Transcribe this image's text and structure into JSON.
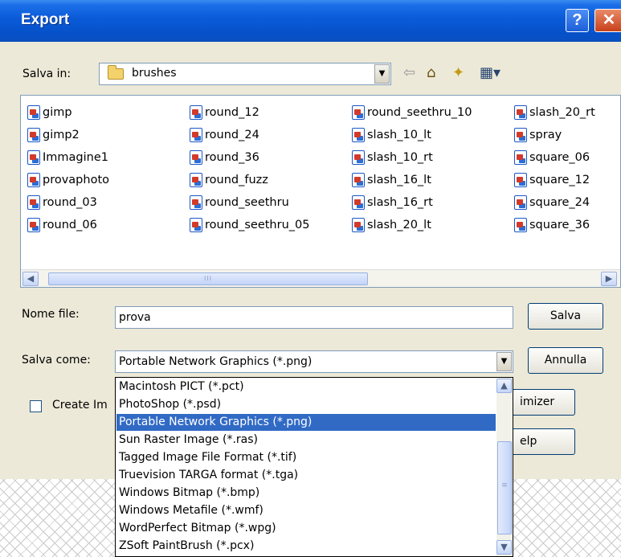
{
  "window": {
    "title": "Export",
    "help_glyph": "?",
    "close_glyph": "✕"
  },
  "location": {
    "label": "Salva in:",
    "folder": "brushes",
    "arrow": "▼",
    "tools": {
      "back": "⇦",
      "up": "⌂",
      "new_folder": "✦",
      "view_menu": "▦▾"
    }
  },
  "files": [
    [
      "gimp",
      "gimp2",
      "Immagine1",
      "provaphoto",
      "round_03",
      "round_06"
    ],
    [
      "round_12",
      "round_24",
      "round_36",
      "round_fuzz",
      "round_seethru",
      "round_seethru_05"
    ],
    [
      "round_seethru_10",
      "slash_10_lt",
      "slash_10_rt",
      "slash_16_lt",
      "slash_16_rt",
      "slash_20_lt"
    ],
    [
      "slash_20_rt",
      "spray",
      "square_06",
      "square_12",
      "square_24",
      "square_36"
    ]
  ],
  "scrollbar": {
    "left": "◀",
    "right": "▶",
    "grip": "III"
  },
  "filename": {
    "label": "Nome file:",
    "value": "prova"
  },
  "save_as": {
    "label": "Salva come:",
    "value": "Portable Network Graphics (*.png)",
    "options": [
      "Macintosh PICT (*.pct)",
      "PhotoShop (*.psd)",
      "Portable Network Graphics (*.png)",
      "Sun Raster Image (*.ras)",
      "Tagged Image File Format (*.tif)",
      "Truevision TARGA format (*.tga)",
      "Windows Bitmap (*.bmp)",
      "Windows Metafile (*.wmf)",
      "WordPerfect Bitmap (*.wpg)",
      "ZSoft PaintBrush (*.pcx)"
    ],
    "selected_index": 2,
    "scroll_up": "▲",
    "scroll_down": "▼",
    "grip": "≡"
  },
  "buttons": {
    "save": "Salva",
    "cancel": "Annulla",
    "optimizer": "imizer",
    "help": "elp"
  },
  "checkbox": {
    "label": "Create Im",
    "checked": false
  }
}
